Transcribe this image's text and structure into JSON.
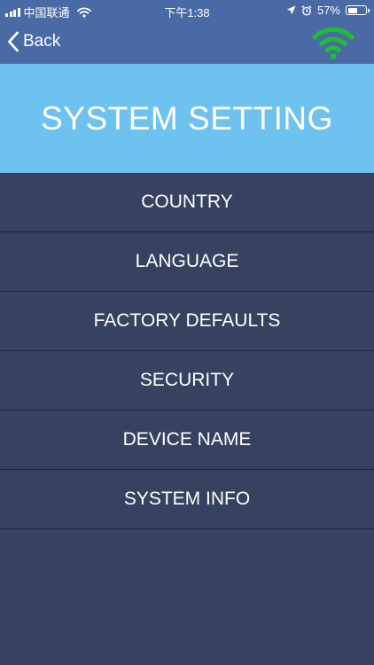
{
  "status_bar": {
    "carrier": "中国联通",
    "time": "下午1:38",
    "battery_percent_label": "57%",
    "battery_level": 0.57,
    "icons": [
      "signal-bars-icon",
      "wifi-icon",
      "location-arrow-icon",
      "alarm-icon",
      "battery-icon"
    ]
  },
  "nav": {
    "back_label": "Back",
    "back_icon": "chevron-left-icon",
    "connection_icon": "wifi-icon",
    "connection_color": "#1fbf2f"
  },
  "header": {
    "title": "SYSTEM SETTING"
  },
  "menu": {
    "items": [
      {
        "label": "COUNTRY"
      },
      {
        "label": "LANGUAGE"
      },
      {
        "label": "FACTORY DEFAULTS"
      },
      {
        "label": "SECURITY"
      },
      {
        "label": "DEVICE NAME"
      },
      {
        "label": "SYSTEM INFO"
      }
    ]
  },
  "colors": {
    "nav_background": "#4a6aa5",
    "title_band": "#6ec2f0",
    "list_background": "#364260",
    "divider": "#1f273a",
    "text": "#ffffff"
  }
}
